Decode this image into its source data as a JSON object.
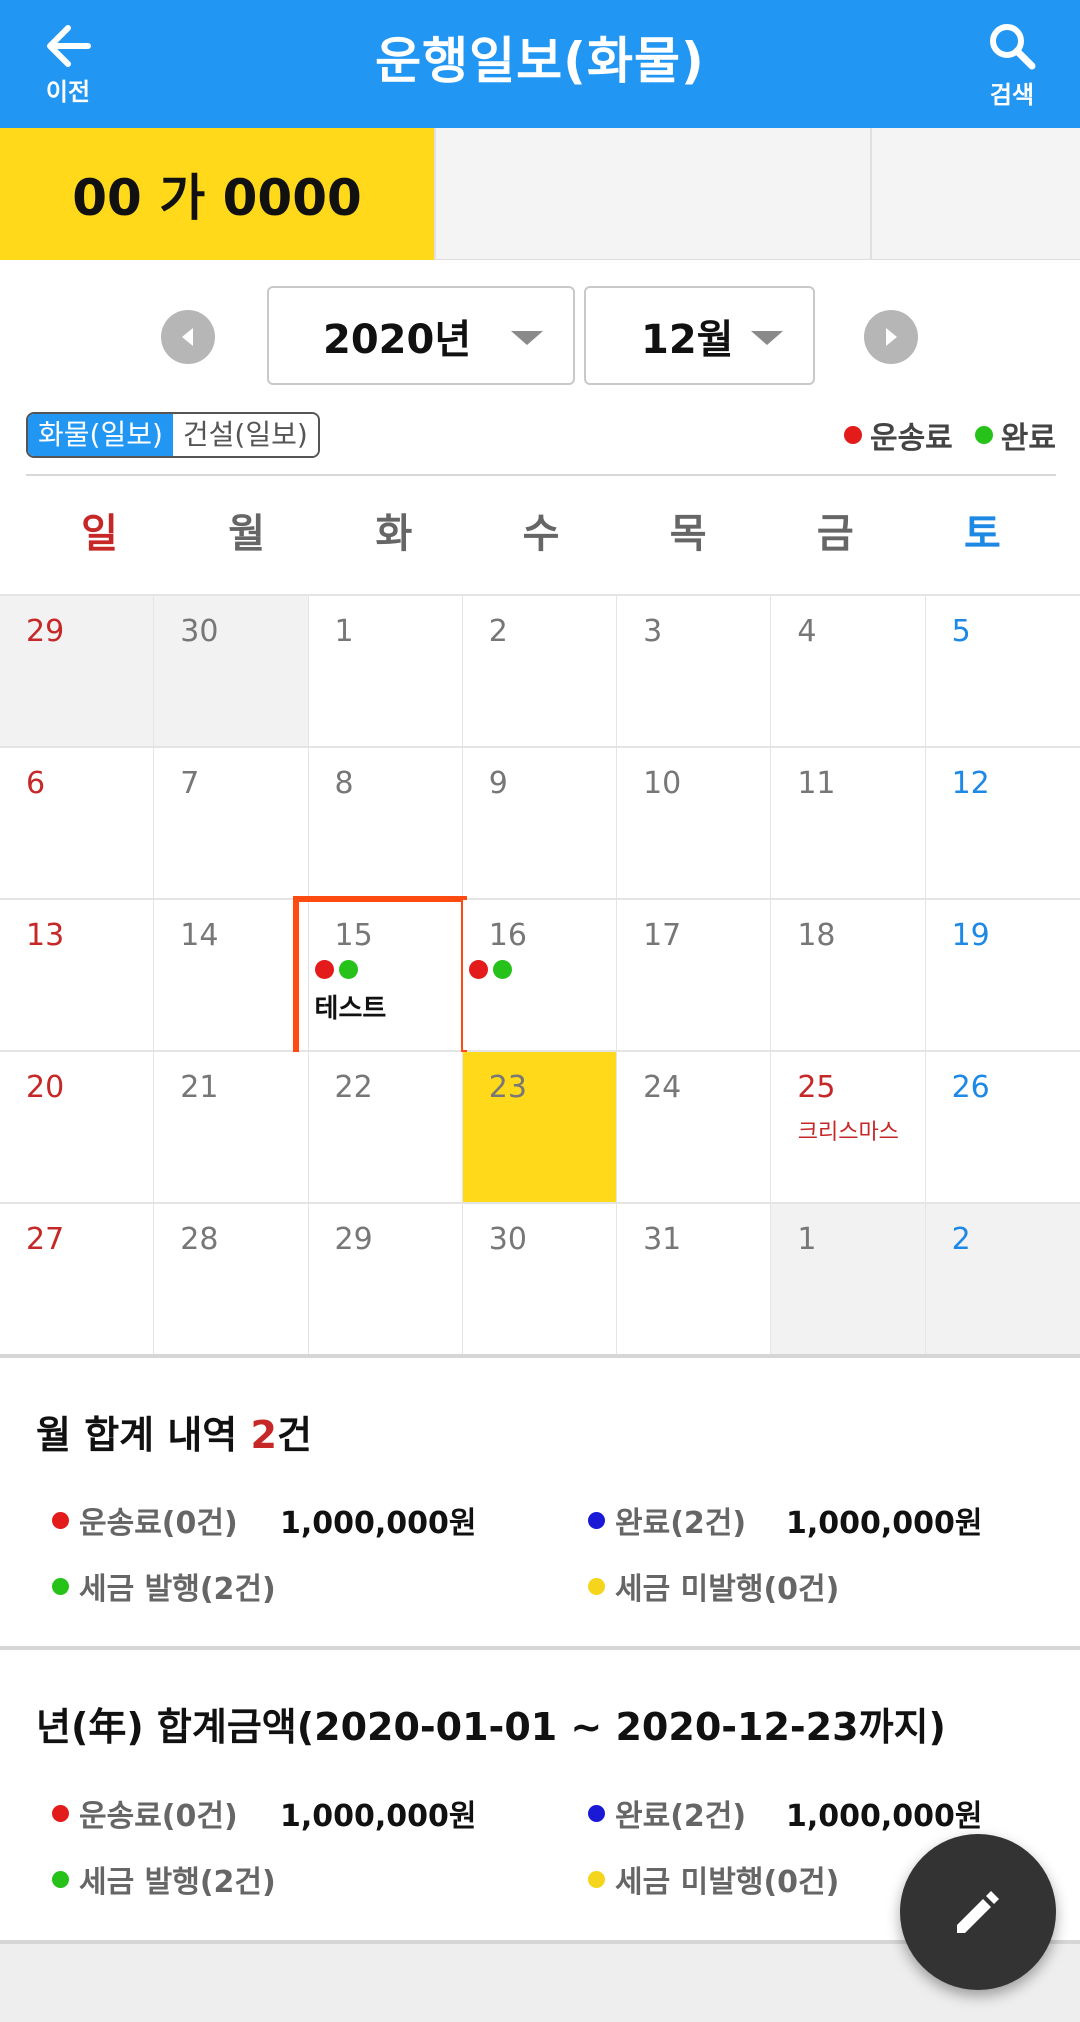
{
  "header": {
    "back_label": "이전",
    "title": "운행일보(화물)",
    "search_label": "검색"
  },
  "vehicle_tabs": [
    {
      "label": "00 가 0000",
      "active": true
    },
    {
      "label": "",
      "active": false
    },
    {
      "label": "",
      "active": false
    }
  ],
  "selector": {
    "year": "2020년",
    "month": "12월"
  },
  "segment": {
    "items": [
      "화물(일보)",
      "건설(일보)"
    ],
    "active_index": 0
  },
  "legend": [
    {
      "label": "운송료",
      "color": "#e31b1b"
    },
    {
      "label": "완료",
      "color": "#26c21a"
    }
  ],
  "weekdays": [
    "일",
    "월",
    "화",
    "수",
    "목",
    "금",
    "토"
  ],
  "calendar": {
    "weeks": [
      [
        "29",
        "30",
        "1",
        "2",
        "3",
        "4",
        "5"
      ],
      [
        "6",
        "7",
        "8",
        "9",
        "10",
        "11",
        "12"
      ],
      [
        "13",
        "14",
        "15",
        "16",
        "17",
        "18",
        "19"
      ],
      [
        "20",
        "21",
        "22",
        "23",
        "24",
        "25",
        "26"
      ],
      [
        "27",
        "28",
        "29",
        "30",
        "31",
        "1",
        "2"
      ]
    ],
    "today": "23",
    "holiday": {
      "day": "25",
      "name": "크리스마스"
    },
    "events": [
      {
        "day": "15",
        "memo": "테스트",
        "dots": [
          "#e31b1b",
          "#26c21a"
        ]
      },
      {
        "day": "16",
        "memo": "",
        "dots": [
          "#e31b1b",
          "#26c21a"
        ]
      }
    ]
  },
  "monthly_summary": {
    "title_prefix": "월 합계 내역 ",
    "count": "2",
    "title_suffix": "건",
    "rows": [
      {
        "label": "운송료(0건)",
        "amount": "1,000,000원",
        "color": "#e31b1b"
      },
      {
        "label": "완료(2건)",
        "amount": "1,000,000원",
        "color": "#1a1ad6"
      },
      {
        "label": "세금 발행(2건)",
        "amount": "",
        "color": "#26c21a"
      },
      {
        "label": "세금 미발행(0건)",
        "amount": "",
        "color": "#f5d51c"
      }
    ]
  },
  "yearly_summary": {
    "title": "년(年) 합계금액(2020-01-01 ~ 2020-12-23까지)",
    "rows": [
      {
        "label": "운송료(0건)",
        "amount": "1,000,000원",
        "color": "#e31b1b"
      },
      {
        "label": "완료(2건)",
        "amount": "1,000,000원",
        "color": "#1a1ad6"
      },
      {
        "label": "세금 발행(2건)",
        "amount": "",
        "color": "#26c21a"
      },
      {
        "label": "세금 미발행(0건)",
        "amount": "",
        "color": "#f5d51c"
      }
    ]
  },
  "fab_icon": "pencil-edit-icon"
}
